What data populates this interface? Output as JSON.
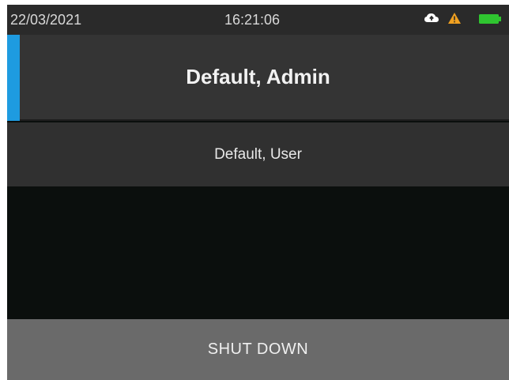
{
  "status_bar": {
    "date": "22/03/2021",
    "time": "16:21:06",
    "icons": [
      "cloud-icon",
      "warning-icon",
      "battery-icon"
    ],
    "warning_color": "#f0a020",
    "battery_color": "#2fc530"
  },
  "users": [
    {
      "label": "Default, Admin",
      "selected": true
    },
    {
      "label": "Default, User",
      "selected": false
    }
  ],
  "accent_color": "#1e9be0",
  "shutdown_label": "SHUT DOWN"
}
